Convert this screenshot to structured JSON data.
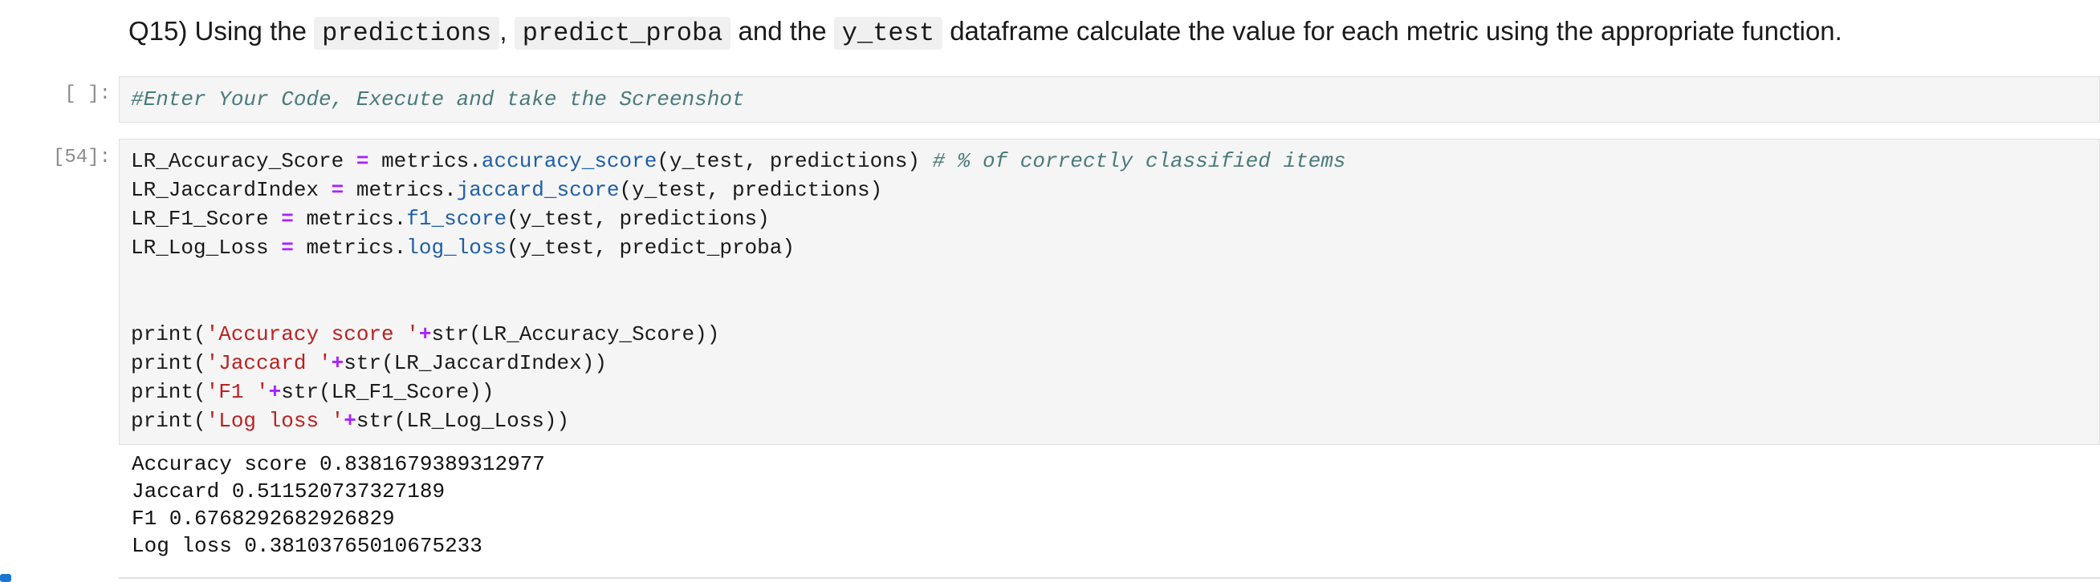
{
  "markdown": {
    "prefix": "Q15) Using the",
    "code1": "predictions",
    "sep1": ",",
    "code2": "predict_proba",
    "and": "and the",
    "code3": "y_test",
    "suffix": "dataframe calculate the value for each metric using the appropriate function."
  },
  "cell1": {
    "prompt": "[ ]:",
    "code": "#Enter Your Code, Execute and take the Screenshot"
  },
  "cell2": {
    "prompt": "[54]:",
    "lines": {
      "l1": {
        "a": "LR_Accuracy_Score",
        "eq": " = ",
        "b": "metrics.",
        "fn": "accuracy_score",
        "c": "(y_test, predictions) ",
        "comment": "# % of correctly classified items"
      },
      "l2": {
        "a": "LR_JaccardIndex",
        "eq": " = ",
        "b": "metrics.",
        "fn": "jaccard_score",
        "c": "(y_test, predictions)"
      },
      "l3": {
        "a": "LR_F1_Score",
        "eq": " = ",
        "b": "metrics.",
        "fn": "f1_score",
        "c": "(y_test, predictions)"
      },
      "l4": {
        "a": "LR_Log_Loss",
        "eq": " = ",
        "b": "metrics.",
        "fn": "log_loss",
        "c": "(y_test, predict_proba)"
      },
      "p1": {
        "a": "print(",
        "s": "'Accuracy score '",
        "op": "+",
        "c": "str(LR_Accuracy_Score))"
      },
      "p2": {
        "a": "print(",
        "s": "'Jaccard '",
        "op": "+",
        "c": "str(LR_JaccardIndex))"
      },
      "p3": {
        "a": "print(",
        "s": "'F1 '",
        "op": "+",
        "c": "str(LR_F1_Score))"
      },
      "p4": {
        "a": "print(",
        "s": "'Log loss '",
        "op": "+",
        "c": "str(LR_Log_Loss))"
      }
    }
  },
  "output": {
    "line1": "Accuracy score 0.8381679389312977",
    "line2": "Jaccard 0.511520737327189",
    "line3": "F1 0.6768292682926829",
    "line4": "Log loss 0.38103765010675233"
  }
}
